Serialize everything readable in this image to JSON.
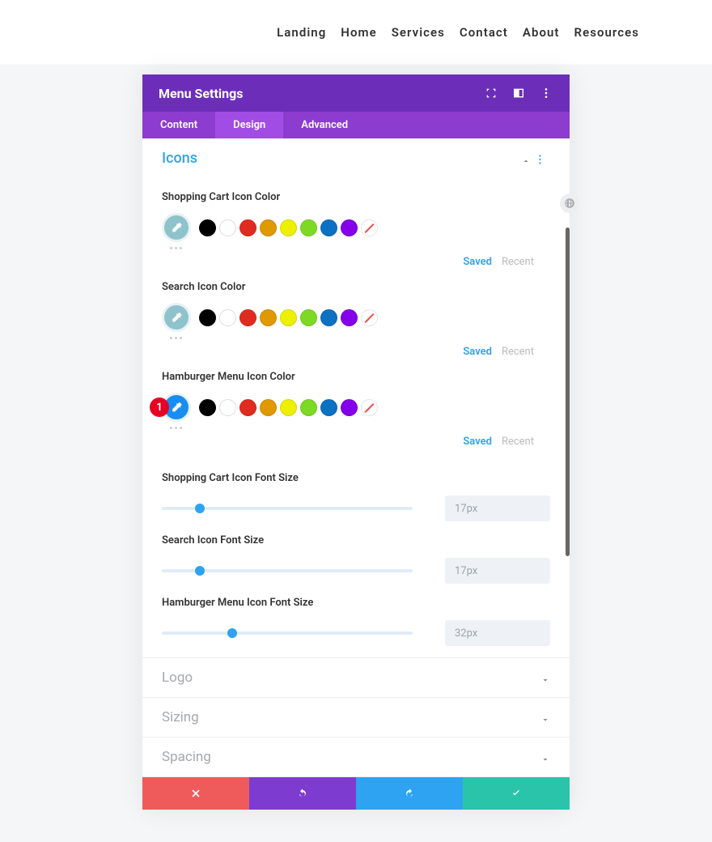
{
  "topnav": [
    "Landing",
    "Home",
    "Services",
    "Contact",
    "About",
    "Resources"
  ],
  "panel": {
    "title": "Menu Settings",
    "tabs": [
      "Content",
      "Design",
      "Advanced"
    ],
    "active_tab": "Design",
    "section_open": {
      "title": "Icons"
    },
    "color_fields": [
      {
        "label": "Shopping Cart Icon Color",
        "picker_bg": "#8fc3cb",
        "badge": null
      },
      {
        "label": "Search Icon Color",
        "picker_bg": "#8fc3cb",
        "badge": null
      },
      {
        "label": "Hamburger Menu Icon Color",
        "picker_bg": "#1a8ef0",
        "badge": "1"
      }
    ],
    "palette": [
      "#000000",
      "#ffffff",
      "#e02b20",
      "#e09900",
      "#edf000",
      "#7cda24",
      "#0c71c3",
      "#8300e9",
      "none"
    ],
    "saved_label": "Saved",
    "recent_label": "Recent",
    "sliders": [
      {
        "label": "Shopping Cart Icon Font Size",
        "value": "17px",
        "pos": 15
      },
      {
        "label": "Search Icon Font Size",
        "value": "17px",
        "pos": 15
      },
      {
        "label": "Hamburger Menu Icon Font Size",
        "value": "32px",
        "pos": 28
      }
    ],
    "sections_collapsed": [
      "Logo",
      "Sizing",
      "Spacing"
    ]
  }
}
